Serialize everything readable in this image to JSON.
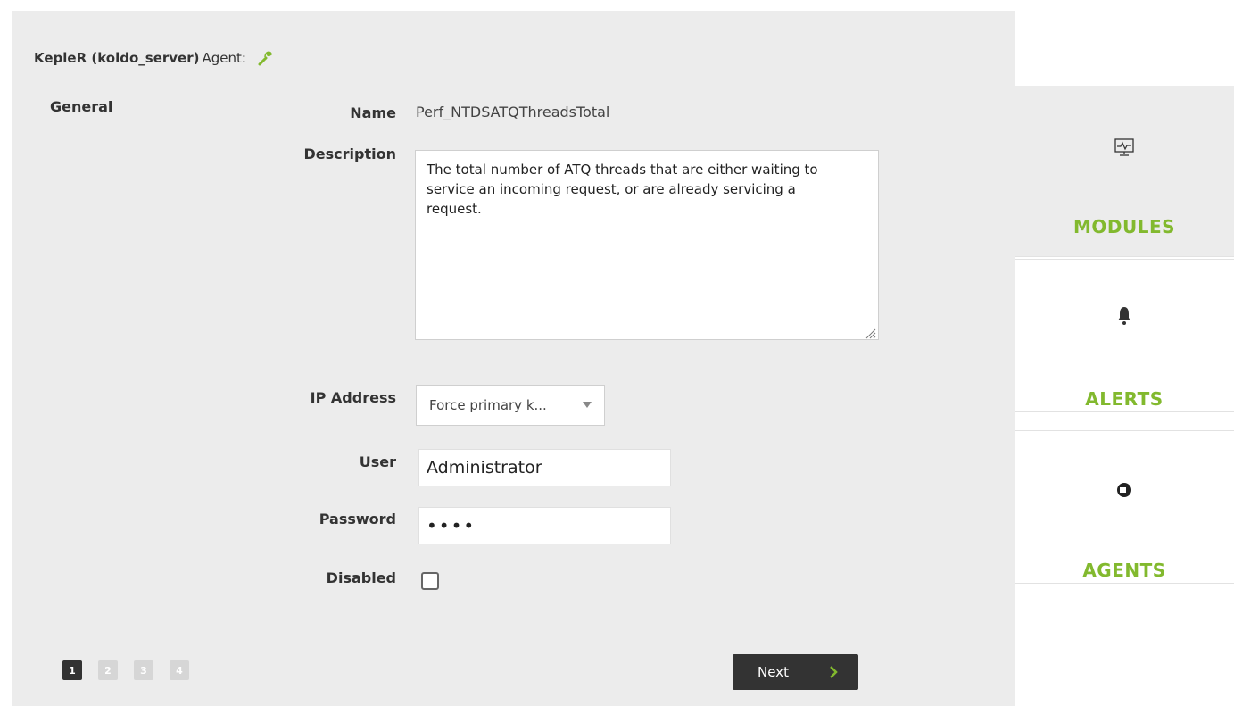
{
  "header": {
    "agent_name": "KepleR (koldo_server)",
    "agent_label": "Agent:",
    "edit_icon": "wrench-icon",
    "accent_color": "#82b92e"
  },
  "form": {
    "section": "General",
    "name_label": "Name",
    "name_value": "Perf_NTDSATQThreadsTotal",
    "description_label": "Description",
    "description_value": "The total number of ATQ threads that are either waiting to service an incoming request, or are already servicing a request.",
    "ip_label": "IP Address",
    "ip_selected": "Force primary k...",
    "user_label": "User",
    "user_value": "Administrator",
    "password_label": "Password",
    "password_value": "••••",
    "disabled_label": "Disabled",
    "disabled_checked": false
  },
  "pagination": {
    "pages": [
      "1",
      "2",
      "3",
      "4"
    ],
    "active": "1"
  },
  "next_button": {
    "label": "Next"
  },
  "side_menu": {
    "items": [
      {
        "label": "MODULES",
        "icon": "monitor-pulse-icon"
      },
      {
        "label": "ALERTS",
        "icon": "bell-icon"
      },
      {
        "label": "AGENTS",
        "icon": "agent-icon"
      }
    ]
  }
}
